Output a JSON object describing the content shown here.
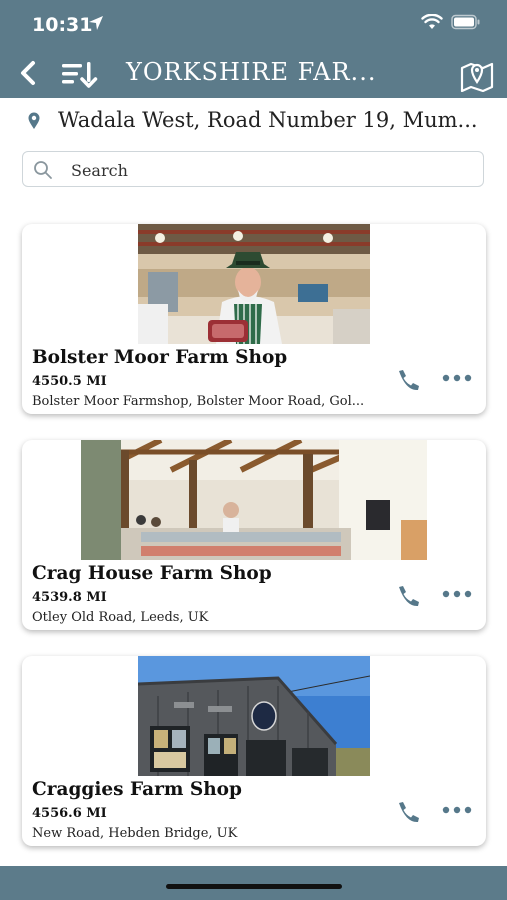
{
  "status": {
    "time": "10:31"
  },
  "nav": {
    "title": "YORKSHIRE FAR..."
  },
  "location": {
    "text": "Wadala West, Road Number 19, Mum..."
  },
  "search": {
    "placeholder": "Search"
  },
  "shops": [
    {
      "name": "Bolster Moor Farm Shop",
      "distance": "4550.5 MI",
      "address": "Bolster Moor Farmshop, Bolster Moor Road, Gol..."
    },
    {
      "name": "Crag House Farm Shop",
      "distance": "4539.8 MI",
      "address": "Otley Old Road, Leeds, UK"
    },
    {
      "name": "Craggies Farm Shop",
      "distance": "4556.6 MI",
      "address": "New Road, Hebden Bridge, UK"
    }
  ],
  "colors": {
    "bar": "#5c7b8a",
    "icon": "#56788a"
  },
  "icons": [
    "location-arrow-icon",
    "wifi-icon",
    "battery-icon",
    "back-icon",
    "sort-icon",
    "map-icon",
    "pin-icon",
    "search-icon",
    "phone-icon",
    "more-icon"
  ]
}
